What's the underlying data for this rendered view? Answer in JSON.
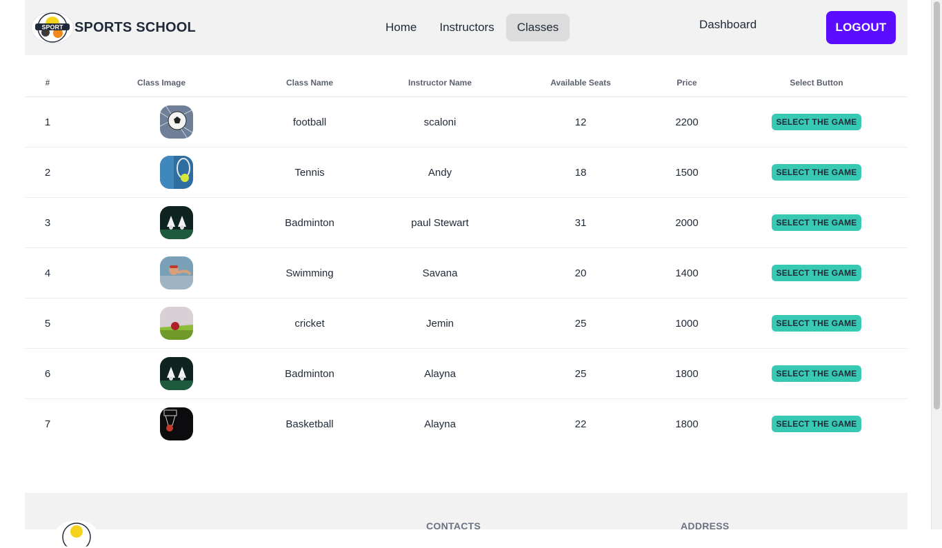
{
  "navbar": {
    "brand": "SPORTS SCHOOL",
    "logo_text": "SPORT",
    "menu": [
      {
        "label": "Home",
        "active": false
      },
      {
        "label": "Instructors",
        "active": false
      },
      {
        "label": "Classes",
        "active": true
      }
    ],
    "dashboard": "Dashboard",
    "logout": "LOGOUT"
  },
  "table": {
    "headers": [
      "#",
      "Class Image",
      "Class Name",
      "Instructor Name",
      "Available Seats",
      "Price",
      "Select Button"
    ],
    "rows": [
      {
        "num": "1",
        "image": "football",
        "class_name": "football",
        "instructor": "scaloni",
        "seats": "12",
        "price": "2200",
        "button": "SELECT THE GAME"
      },
      {
        "num": "2",
        "image": "tennis",
        "class_name": "Tennis",
        "instructor": "Andy",
        "seats": "18",
        "price": "1500",
        "button": "SELECT THE GAME"
      },
      {
        "num": "3",
        "image": "badminton",
        "class_name": "Badminton",
        "instructor": "paul Stewart",
        "seats": "31",
        "price": "2000",
        "button": "SELECT THE GAME"
      },
      {
        "num": "4",
        "image": "swimming",
        "class_name": "Swimming",
        "instructor": "Savana",
        "seats": "20",
        "price": "1400",
        "button": "SELECT THE GAME"
      },
      {
        "num": "5",
        "image": "cricket",
        "class_name": "cricket",
        "instructor": "Jemin",
        "seats": "25",
        "price": "1000",
        "button": "SELECT THE GAME"
      },
      {
        "num": "6",
        "image": "badminton",
        "class_name": "Badminton",
        "instructor": "Alayna",
        "seats": "25",
        "price": "1800",
        "button": "SELECT THE GAME"
      },
      {
        "num": "7",
        "image": "basketball",
        "class_name": "Basketball",
        "instructor": "Alayna",
        "seats": "22",
        "price": "1800",
        "button": "SELECT THE GAME"
      }
    ]
  },
  "footer": {
    "contacts": "CONTACTS",
    "address": "ADDRESS"
  },
  "colors": {
    "accent": "#5a0dff",
    "select_button": "#38c9b4",
    "navbar_bg": "#f2f2f2"
  }
}
